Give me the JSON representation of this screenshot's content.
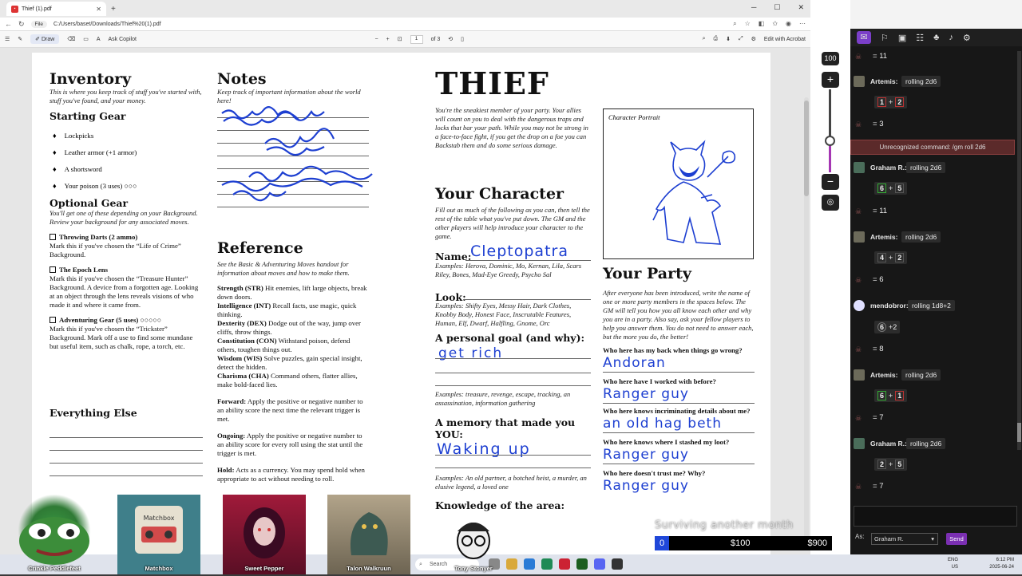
{
  "browser": {
    "tab_title": "Thief (1).pdf",
    "address_chip": "File",
    "url": "C:/Users/baset/Downloads/Thief%20(1).pdf",
    "toolbar": {
      "draw": "Draw",
      "ask_copilot": "Ask Copilot",
      "page_current": "1",
      "page_total": "of 3",
      "edit_acrobat": "Edit with Acrobat"
    }
  },
  "pdf": {
    "inventory": {
      "title": "Inventory",
      "intro": "This is where you keep track of stuff you've started with, stuff you've found, and your money.",
      "starting_gear_title": "Starting Gear",
      "starting_gear": [
        "Lockpicks",
        "Leather armor (+1 armor)",
        "A shortsword",
        "Your poison (3 uses) ○○○"
      ],
      "optional_gear_title": "Optional Gear",
      "optional_intro": "You'll get one of these depending on your Background. Review your background for any associated moves.",
      "options": [
        {
          "name": "Throwing Darts (2 ammo)",
          "desc": "Mark this if you've chosen the “Life of Crime” Background."
        },
        {
          "name": "The Epoch Lens",
          "desc": "Mark this if you've chosen the “Treasure Hunter” Background. A device from a forgotten age. Looking at an object through the lens reveals visions of who made it and where it came from."
        },
        {
          "name": "Adventuring Gear (5 uses) ○○○○○",
          "desc": "Mark this if you've chosen the “Trickster” Background. Mark off a use to find some mundane but useful item, such as chalk, rope, a torch, etc."
        }
      ],
      "everything_else_title": "Everything Else"
    },
    "notes": {
      "title": "Notes",
      "intro": "Keep track of important information about the world here!"
    },
    "reference": {
      "title": "Reference",
      "intro": "See the Basic & Adventuring Moves handout for information about moves and how to make them.",
      "stats": [
        {
          "name": "Strength (STR)",
          "desc": "Hit enemies, lift large objects, break down doors."
        },
        {
          "name": "Intelligence (INT)",
          "desc": "Recall facts, use magic, quick thinking."
        },
        {
          "name": "Dexterity (DEX)",
          "desc": "Dodge out of the way, jump over cliffs, throw things."
        },
        {
          "name": "Constitution (CON)",
          "desc": "Withstand poison, defend others, toughen things out."
        },
        {
          "name": "Wisdom (WIS)",
          "desc": "Solve puzzles, gain special insight, detect the hidden."
        },
        {
          "name": "Charisma (CHA)",
          "desc": "Command others, flatter allies, make bold-faced lies."
        }
      ],
      "terms": [
        {
          "name": "Forward:",
          "desc": "Apply the positive or negative number to an ability score the next time the relevant trigger is met."
        },
        {
          "name": "Ongoing:",
          "desc": "Apply the positive or negative number to an ability score for every roll using the stat until the trigger is met."
        },
        {
          "name": "Hold:",
          "desc": "Acts as a currency. You may spend hold when appropriate to act without needing to roll."
        }
      ]
    },
    "thief": {
      "title": "THIEF",
      "intro": "You're the sneakiest member of your party. Your allies will count on you to deal with the dangerous traps and locks that bar your path. While you may not be strong in a face-to-face fight, if you get the drop on a foe you can Backstab them and do some serious damage."
    },
    "character": {
      "title": "Your Character",
      "intro": "Fill out as much of the following as you can, then tell the rest of the table what you've put down. The GM and the other players will help introduce your character to the game.",
      "name_label": "Name:",
      "name_value": "Cleptopatra",
      "name_examples": "Examples: Herova, Dominic, Mo, Kernan, Lila, Scars Riley, Bones, Mad-Eye Greedy, Psycho Sal",
      "look_label": "Look:",
      "look_examples": "Examples: Shifty Eyes, Messy Hair, Dark Clothes, Knobby Body, Honest Face, Inscrutable Features, Human, Elf, Dwarf, Halfling, Gnome, Orc",
      "goal_label": "A personal goal (and why):",
      "goal_value": "get rich",
      "goal_examples": "Examples: treasure, revenge, escape, tracking, an assassination, information gathering",
      "memory_label": "A memory that made you YOU:",
      "memory_value": "Waking up",
      "memory_examples": "Examples: An old partner, a botched heist, a murder, an elusive legend, a loved one",
      "knowledge_label": "Knowledge of the area:"
    },
    "portrait": {
      "label": "Character Portrait"
    },
    "party": {
      "title": "Your Party",
      "intro": "After everyone has been introduced, write the name of one or more party members in the spaces below. The GM will tell you how you all know each other and why you are in a party. Also say, ask your fellow players to help you answer them. You do not need to answer each, but the more you do, the better!",
      "questions": [
        {
          "q": "Who here has my back when things go wrong?",
          "a": "Andoran"
        },
        {
          "q": "Who here have I worked with before?",
          "a": "Ranger guy"
        },
        {
          "q": "Who here knows incriminating details about me?",
          "a": "an old hag beth"
        },
        {
          "q": "Who here knows where I stashed my loot?",
          "a": "Ranger guy"
        },
        {
          "q": "Who here doesn't trust me? Why?",
          "a": "Ranger guy"
        }
      ]
    }
  },
  "zoom": {
    "percent": "100",
    "plus": "+",
    "minus": "−"
  },
  "chat": {
    "messages": [
      {
        "type": "result",
        "value": "11"
      },
      {
        "type": "roll",
        "name": "Artemis:",
        "cmd": "rolling 2d6",
        "dice": [
          "1",
          "+",
          "2"
        ],
        "result": "3"
      },
      {
        "type": "error",
        "text": "Unrecognized command: /gm roll 2d6"
      },
      {
        "type": "roll",
        "name": "Graham R.:",
        "cmd": "rolling 2d6",
        "dice": [
          "6",
          "+",
          "5"
        ],
        "result": "11"
      },
      {
        "type": "roll",
        "name": "Artemis:",
        "cmd": "rolling 2d6",
        "dice": [
          "4",
          "+",
          "2"
        ],
        "result": "6"
      },
      {
        "type": "roll",
        "name": "mendobror:",
        "cmd": "rolling 1d8+2",
        "dice": [
          "6",
          "+2"
        ],
        "result": "8"
      },
      {
        "type": "roll",
        "name": "Artemis:",
        "cmd": "rolling 2d6",
        "dice": [
          "6",
          "+",
          "1"
        ],
        "result": "7"
      },
      {
        "type": "roll",
        "name": "Graham R.:",
        "cmd": "rolling 2d6",
        "dice": [
          "2",
          "+",
          "5"
        ],
        "result": "7"
      }
    ],
    "as_label": "As:",
    "as_value": "Graham R.",
    "send": "Send"
  },
  "overlay": {
    "marquee": "Surviving another month",
    "ticker_start": "0",
    "ticker_mid": "$100",
    "ticker_end": "$900",
    "avatars": [
      "Crinkle Peddlefeet",
      "Matchbox",
      "Sweet Pepper",
      "Talon Walkruun",
      "Tony Stonyer"
    ]
  },
  "taskbar": {
    "search": "Search",
    "lang": "ENG US",
    "time": "6:12 PM",
    "date": "2025-06-24"
  }
}
